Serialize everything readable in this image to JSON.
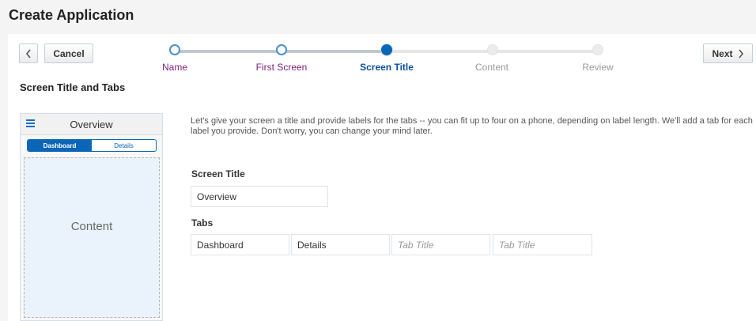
{
  "page": {
    "title": "Create Application"
  },
  "toolbar": {
    "back_icon": "chevron-left-icon",
    "cancel_label": "Cancel",
    "next_label": "Next",
    "next_icon": "chevron-right-icon"
  },
  "train": {
    "steps": [
      {
        "label": "Name",
        "state": "visited"
      },
      {
        "label": "First Screen",
        "state": "visited"
      },
      {
        "label": "Screen Title",
        "state": "current"
      },
      {
        "label": "Content",
        "state": "unvisited"
      },
      {
        "label": "Review",
        "state": "unvisited"
      }
    ]
  },
  "section": {
    "heading": "Screen Title and Tabs"
  },
  "preview": {
    "menu_icon": "hamburger-menu-icon",
    "title": "Overview",
    "tabs": [
      {
        "label": "Dashboard",
        "active": true
      },
      {
        "label": "Details",
        "active": false
      }
    ],
    "content_label": "Content"
  },
  "form": {
    "intro": "Let's give your screen a title and provide labels for the tabs -- you can fit up to four on a phone, depending on label length. We'll add a tab for each label you provide. Don't worry, you can change your mind later.",
    "screen_title_label": "Screen Title",
    "screen_title_value": "Overview",
    "tabs_label": "Tabs",
    "tab_fields": [
      {
        "value": "Dashboard",
        "placeholder": "Tab Title"
      },
      {
        "value": "Details",
        "placeholder": "Tab Title"
      },
      {
        "value": "",
        "placeholder": "Tab Title"
      },
      {
        "value": "",
        "placeholder": "Tab Title"
      }
    ]
  },
  "colors": {
    "accent": "#0b66b7",
    "visited": "#7b1c7b",
    "disabled": "#9a9a9a"
  }
}
